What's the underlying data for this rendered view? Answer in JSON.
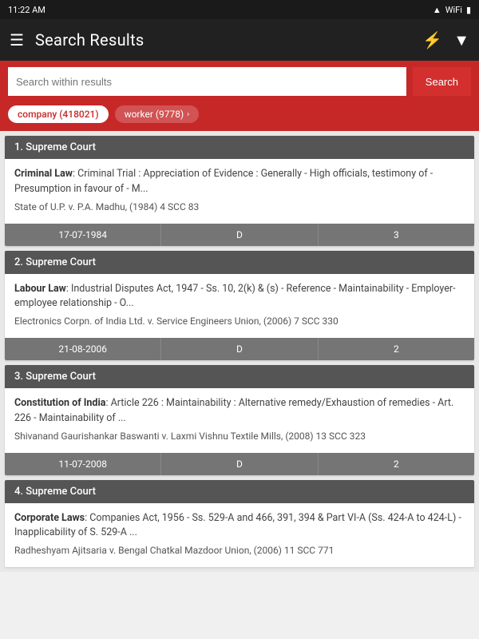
{
  "statusBar": {
    "time": "11:22 AM"
  },
  "appBar": {
    "menuIcon": "☰",
    "title": "Search Results",
    "flashIcon": "⚡",
    "filterIcon": "▼"
  },
  "searchBar": {
    "placeholder": "Search within results",
    "buttonLabel": "Search"
  },
  "chips": [
    {
      "label": "company (418021)",
      "active": true
    },
    {
      "label": "worker (9778)",
      "active": false
    }
  ],
  "results": [
    {
      "id": "1",
      "court": "1. Supreme Court",
      "lawType": "Criminal Law",
      "description": ": Criminal Trial : Appreciation of Evidence : Generally - High officials, testimony of - Presumption in favour of - M...",
      "caseTitle": "State of U.P. v. P.A. Madhu, (1984) 4 SCC 83",
      "date": "17-07-1984",
      "code": "D",
      "number": "3"
    },
    {
      "id": "2",
      "court": "2. Supreme Court",
      "lawType": "Labour Law",
      "description": ": Industrial Disputes Act, 1947 - Ss. 10, 2(k) & (s) - Reference - Maintainability - Employer-employee relationship - O...",
      "caseTitle": "Electronics Corpn. of India Ltd. v. Service Engineers Union, (2006) 7 SCC 330",
      "date": "21-08-2006",
      "code": "D",
      "number": "2"
    },
    {
      "id": "3",
      "court": "3. Supreme Court",
      "lawType": "Constitution of India",
      "description": ": Article 226 : Maintainability : Alternative remedy/Exhaustion of remedies - Art. 226 - Maintainability of ...",
      "caseTitle": "Shivanand Gaurishankar Baswanti v. Laxmi Vishnu Textile Mills, (2008) 13 SCC 323",
      "date": "11-07-2008",
      "code": "D",
      "number": "2"
    },
    {
      "id": "4",
      "court": "4. Supreme Court",
      "lawType": "Corporate Laws",
      "description": ": Companies Act, 1956 - Ss. 529-A and 466, 391, 394 & Part VI-A (Ss. 424-A to 424-L) - Inapplicability of S. 529-A ...",
      "caseTitle": "Radheshyam Ajitsaria v. Bengal Chatkal Mazdoor Union, (2006) 11 SCC 771",
      "date": "",
      "code": "",
      "number": ""
    }
  ]
}
